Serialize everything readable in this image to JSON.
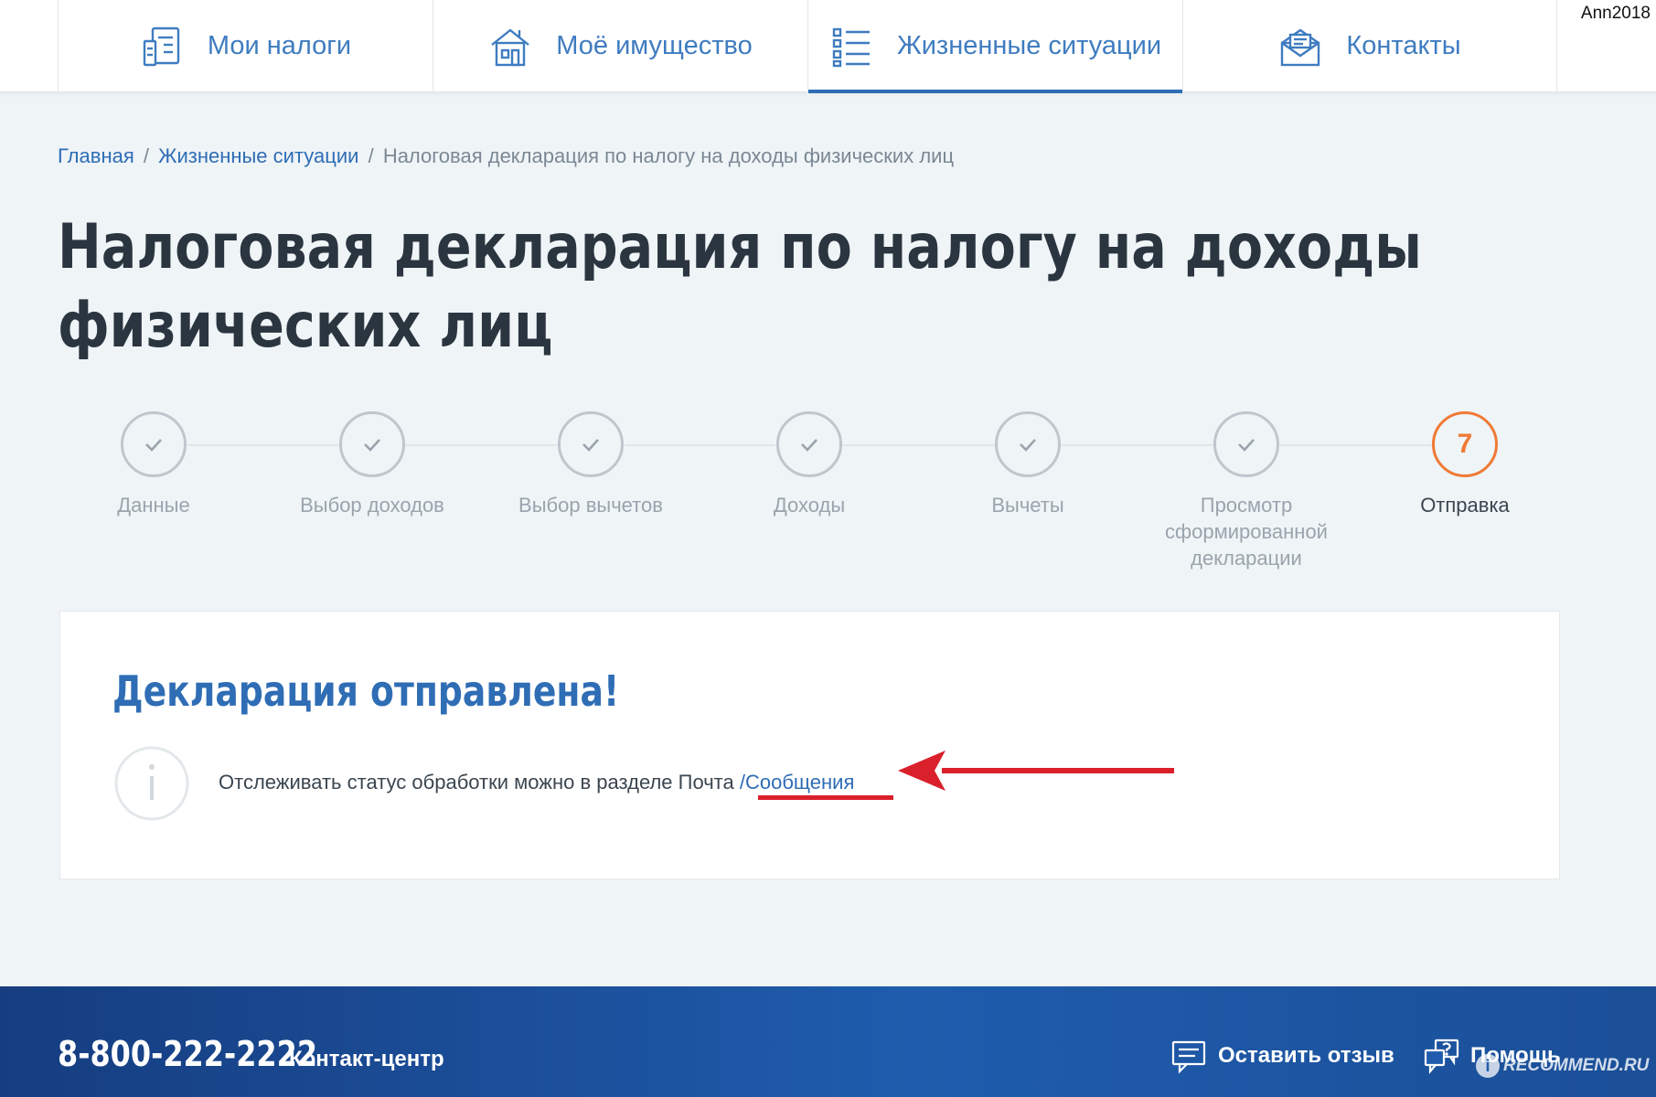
{
  "user": {
    "name": "Ann2018"
  },
  "nav": {
    "tabs": [
      {
        "label": "Мои налоги",
        "icon": "tax-documents-icon",
        "active": false
      },
      {
        "label": "Моё имущество",
        "icon": "property-house-icon",
        "active": false
      },
      {
        "label": "Жизненные ситуации",
        "icon": "list-icon",
        "active": true
      },
      {
        "label": "Контакты",
        "icon": "envelope-icon",
        "active": false
      }
    ]
  },
  "breadcrumb": {
    "home": "Главная",
    "sep": "/",
    "section": "Жизненные ситуации",
    "current": "Налоговая декларация по налогу на доходы физических лиц"
  },
  "page": {
    "title": "Налоговая декларация по налогу на доходы физических лиц"
  },
  "stepper": {
    "steps": [
      {
        "label": "Данные",
        "status": "done"
      },
      {
        "label": "Выбор доходов",
        "status": "done"
      },
      {
        "label": "Выбор вычетов",
        "status": "done"
      },
      {
        "label": "Доходы",
        "status": "done"
      },
      {
        "label": "Вычеты",
        "status": "done"
      },
      {
        "label": "Просмотр сформированной декларации",
        "status": "done"
      },
      {
        "label": "Отправка",
        "status": "current",
        "number": "7"
      }
    ]
  },
  "result": {
    "title": "Декларация отправлена!",
    "info_text": "Отслеживать статус обработки можно в разделе Почта",
    "info_link": "/Сообщения"
  },
  "footer": {
    "phone": "8-800-222-2222",
    "contact_label": "Контакт-центр",
    "feedback_label": "Оставить отзыв",
    "help_label": "Помощь"
  },
  "watermark": {
    "text": "RECOMMEND.RU"
  },
  "colors": {
    "brand_blue": "#2f6db5",
    "current_step": "#f07a35",
    "annotation_red": "#d9202b",
    "footer_blue": "#1f5cad"
  }
}
